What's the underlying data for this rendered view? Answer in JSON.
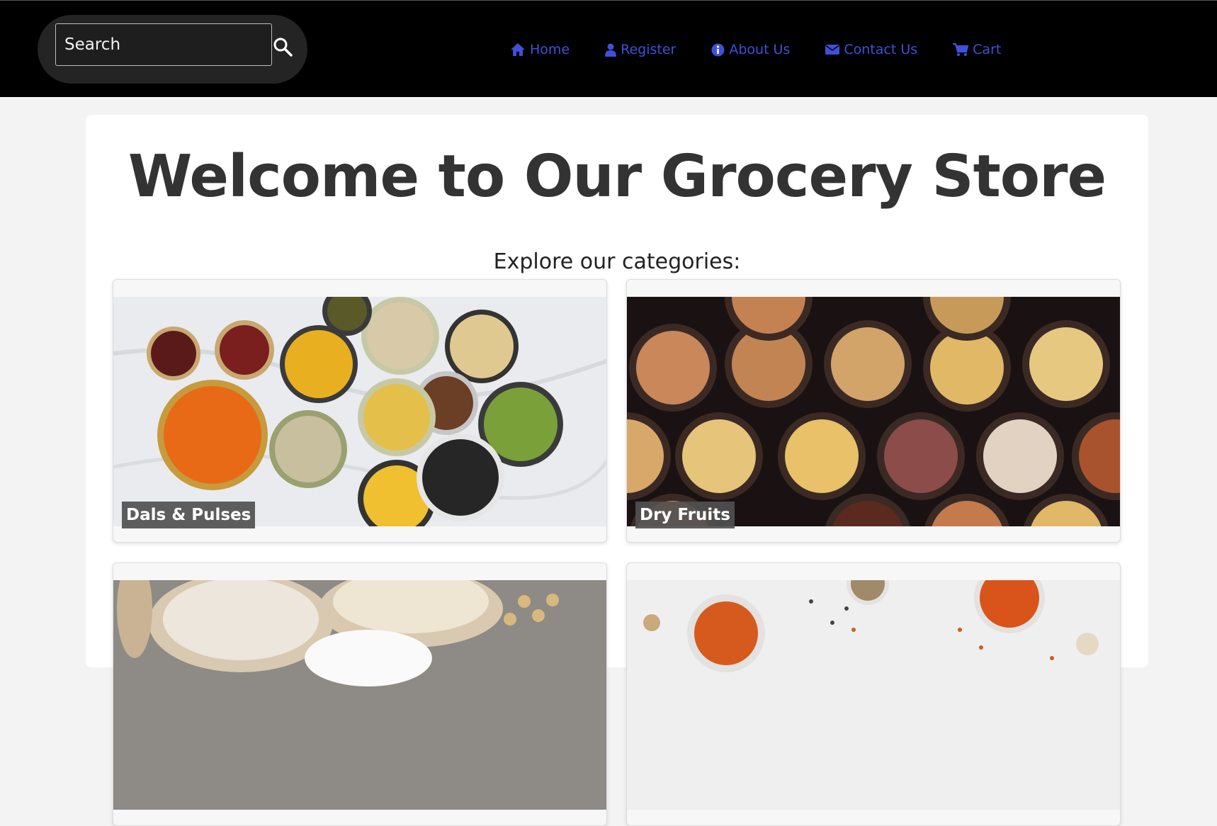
{
  "search": {
    "placeholder": "Search"
  },
  "nav": {
    "items": [
      {
        "label": "Home",
        "icon": "home-icon"
      },
      {
        "label": "Register",
        "icon": "user-icon"
      },
      {
        "label": "About Us",
        "icon": "info-icon"
      },
      {
        "label": "Contact Us",
        "icon": "envelope-icon"
      },
      {
        "label": "Cart",
        "icon": "cart-icon"
      }
    ],
    "color": "#3f51d8"
  },
  "main": {
    "title": "Welcome to Our Grocery Store",
    "subtitle": "Explore our categories:",
    "categories": [
      {
        "label": "Dals & Pulses"
      },
      {
        "label": "Dry Fruits"
      },
      {
        "label": ""
      },
      {
        "label": ""
      }
    ]
  }
}
